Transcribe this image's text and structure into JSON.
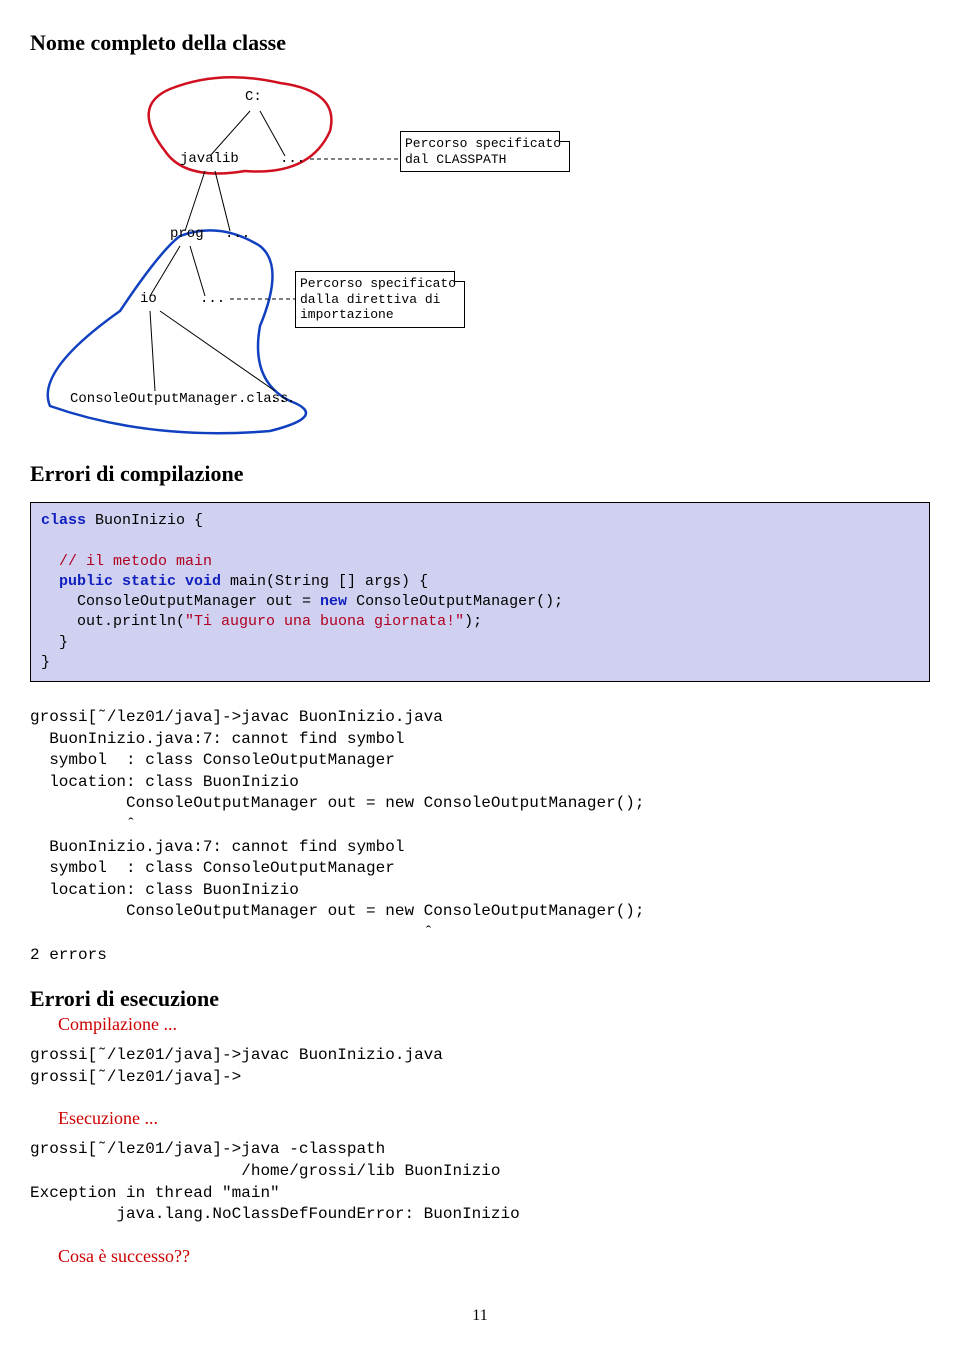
{
  "title1": "Nome completo della classe",
  "diagram": {
    "c": "C:",
    "javalib": "javalib",
    "dots": "...",
    "prog": "prog",
    "io": "io",
    "com": "ConsoleOutputManager.class",
    "note1a": "Percorso specificato",
    "note1b": "dal CLASSPATH",
    "note2a": "Percorso specificato",
    "note2b": "dalla direttiva di",
    "note2c": "importazione"
  },
  "title2": "Errori di compilazione",
  "code": {
    "l0": "class",
    "l0b": " BuonInizio {",
    "l1": "  // il metodo main",
    "l2a": "  public static void",
    "l2b": " main(String [] args) {",
    "l3a": "    ConsoleOutputManager out = ",
    "l3b": "new",
    "l3c": " ConsoleOutputManager();",
    "l4a": "    out.println(",
    "l4b": "\"Ti auguro una buona giornata!\"",
    "l4c": ");",
    "l5": "  }",
    "l6": "}"
  },
  "err1": "grossi[˜/lez01/java]->javac BuonInizio.java\n  BuonInizio.java:7: cannot find symbol\n  symbol  : class ConsoleOutputManager\n  location: class BuonInizio\n          ConsoleOutputManager out = new ConsoleOutputManager();\n          ˆ\n  BuonInizio.java:7: cannot find symbol\n  symbol  : class ConsoleOutputManager\n  location: class BuonInizio\n          ConsoleOutputManager out = new ConsoleOutputManager();\n                                         ˆ\n2 errors",
  "title3": "Errori di esecuzione",
  "compile_lbl": "Compilazione ...",
  "compile_out": "grossi[˜/lez01/java]->javac BuonInizio.java\ngrossi[˜/lez01/java]->",
  "exec_lbl": "Esecuzione ...",
  "exec_out": "grossi[˜/lez01/java]->java -classpath\n                      /home/grossi/lib BuonInizio\nException in thread \"main\"\n         java.lang.NoClassDefFoundError: BuonInizio",
  "cosa": "Cosa è successo??",
  "page": "11"
}
